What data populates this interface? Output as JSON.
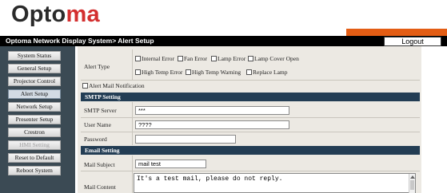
{
  "brand": {
    "logo_text_1": "Opto",
    "logo_text_2": "ma"
  },
  "header": {
    "title": "Optoma Network Display System> Alert Setup",
    "logout_label": "Logout"
  },
  "sidebar": {
    "items": [
      {
        "label": "System Status"
      },
      {
        "label": "General Setup"
      },
      {
        "label": "Projector Control"
      },
      {
        "label": "Alert Setup"
      },
      {
        "label": "Network Setup"
      },
      {
        "label": "Presenter Setup"
      },
      {
        "label": "Crestron"
      },
      {
        "label": "HMI Setting"
      },
      {
        "label": "Reset to Default"
      },
      {
        "label": "Reboot System"
      }
    ]
  },
  "alert": {
    "type_label": "Alert Type",
    "options": [
      "Internal Error",
      "Fan Error",
      "Lamp Error",
      "Lamp Cover Open",
      "High Temp Error",
      "High Temp Warning",
      "Replace Lamp"
    ],
    "notification_label": "Alert Mail Notification"
  },
  "smtp": {
    "section_title": "SMTP Setting",
    "server_label": "SMTP Server",
    "server_value": "***",
    "user_label": "User Name",
    "user_value": "????",
    "password_label": "Password",
    "password_value": ""
  },
  "email": {
    "section_title": "Email Setting",
    "subject_label": "Mail Subject",
    "subject_value": "mail test",
    "content_label": "Mail Content",
    "content_value": "It's a test mail, please do not reply."
  },
  "colors": {
    "accent_orange": "#e35d14",
    "section_bar": "#233d54",
    "sidebar_bg": "#3b4a54"
  }
}
